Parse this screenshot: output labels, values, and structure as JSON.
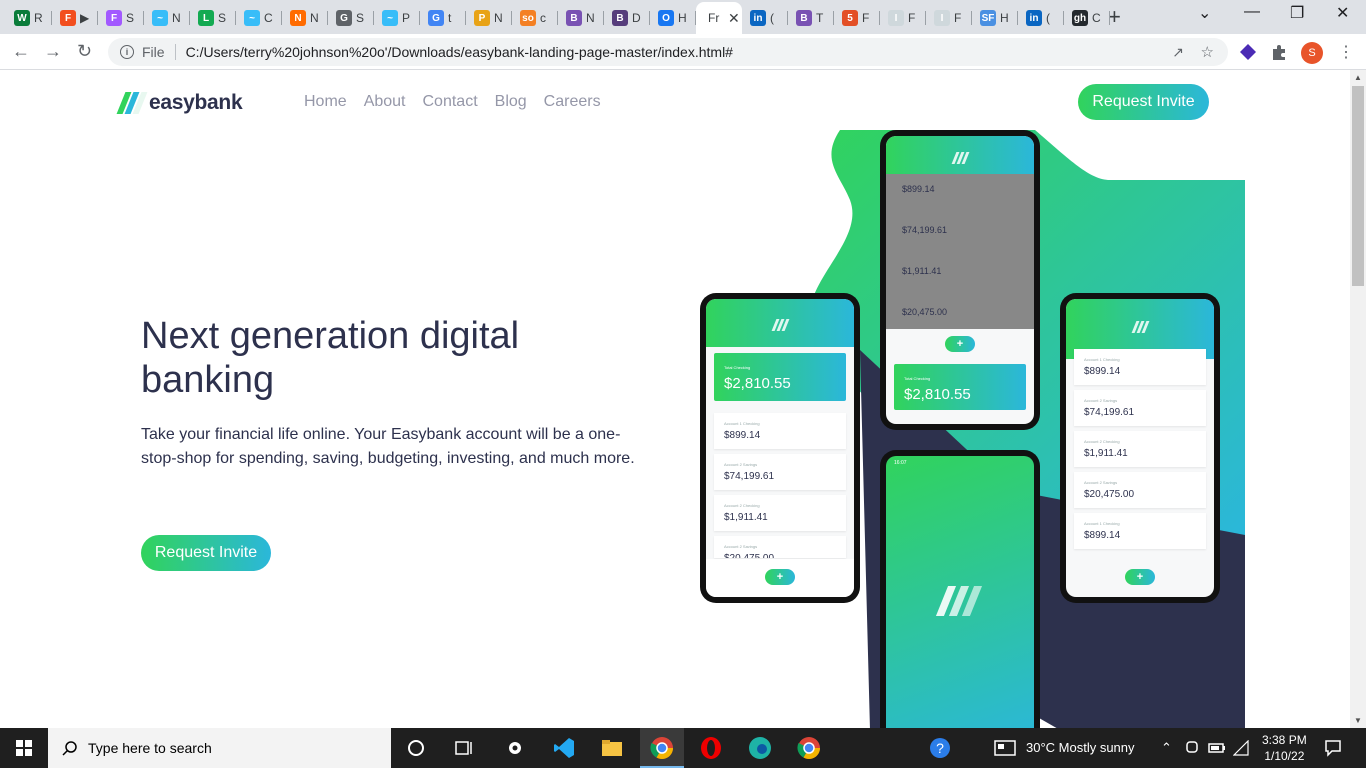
{
  "browser": {
    "tabs": [
      {
        "fav": "W",
        "color": "#0a7c3a",
        "label": "R"
      },
      {
        "fav": "figma",
        "color": "#f24e1e",
        "label": "▶"
      },
      {
        "fav": "figma",
        "color": "#a259ff",
        "label": "S"
      },
      {
        "fav": "~",
        "color": "#38bdf8",
        "label": "N"
      },
      {
        "fav": "leaf",
        "color": "#13aa52",
        "label": "S"
      },
      {
        "fav": "~",
        "color": "#38bdf8",
        "label": "C"
      },
      {
        "fav": "N",
        "color": "#ff6b00",
        "label": "N"
      },
      {
        "fav": "globe",
        "color": "#5f6368",
        "label": "S"
      },
      {
        "fav": "~",
        "color": "#38bdf8",
        "label": "P"
      },
      {
        "fav": "G",
        "color": "#4285f4",
        "label": "t"
      },
      {
        "fav": "pen",
        "color": "#e8a317",
        "label": "N"
      },
      {
        "fav": "so",
        "color": "#f48024",
        "label": "c"
      },
      {
        "fav": "B",
        "color": "#7952b3",
        "label": "N"
      },
      {
        "fav": "B",
        "color": "#563d7c",
        "label": "D"
      },
      {
        "fav": "O",
        "color": "#1877f2",
        "label": "H"
      },
      {
        "fav": "",
        "color": "#ffffff",
        "label": "Fr"
      },
      {
        "fav": "in",
        "color": "#0a66c2",
        "label": "("
      },
      {
        "fav": "B",
        "color": "#7952b3",
        "label": "T"
      },
      {
        "fav": "5",
        "color": "#e34f26",
        "label": "F"
      },
      {
        "fav": "img",
        "color": "#cfd8dc",
        "label": "F"
      },
      {
        "fav": "img",
        "color": "#cfd8dc",
        "label": "F"
      },
      {
        "fav": "SF",
        "color": "#4a90e2",
        "label": "H"
      },
      {
        "fav": "in",
        "color": "#0a66c2",
        "label": "("
      },
      {
        "fav": "gh",
        "color": "#24292e",
        "label": "C"
      }
    ],
    "active_tab_index": 15,
    "url_scheme_label": "File",
    "url": "C:/Users/terry%20johnson%20o'/Downloads/easybank-landing-page-master/index.html#",
    "profile_initial": "S"
  },
  "page": {
    "brand": "easybank",
    "nav": [
      "Home",
      "About",
      "Contact",
      "Blog",
      "Careers"
    ],
    "header_cta": "Request Invite",
    "headline": "Next generation digital banking",
    "lead": "Take your financial life online. Your Easybank account will be a one-stop-shop for spending, saving, budgeting, investing, and much more.",
    "hero_cta": "Request Invite",
    "mockup": {
      "total_label": "Total Checking",
      "total_amount": "$2,810.55",
      "accounts": [
        {
          "label": "Account 1 Checking",
          "amount": "$899.14"
        },
        {
          "label": "Account 2 Savings",
          "amount": "$74,199.61"
        },
        {
          "label": "Account 2 Checking",
          "amount": "$1,911.41"
        },
        {
          "label": "Account 2 Savings",
          "amount": "$20,475.00"
        },
        {
          "label": "Account 1 Checking",
          "amount": "$899.14"
        }
      ],
      "status_time": "16:07"
    },
    "colors": {
      "green": "#31d35c",
      "cyan": "#2bb7da",
      "navy": "#2d314d",
      "grey": "#9597a8"
    }
  },
  "taskbar": {
    "search_placeholder": "Type here to search",
    "weather": "30°C  Mostly sunny",
    "time": "3:38 PM",
    "date": "1/10/22"
  }
}
